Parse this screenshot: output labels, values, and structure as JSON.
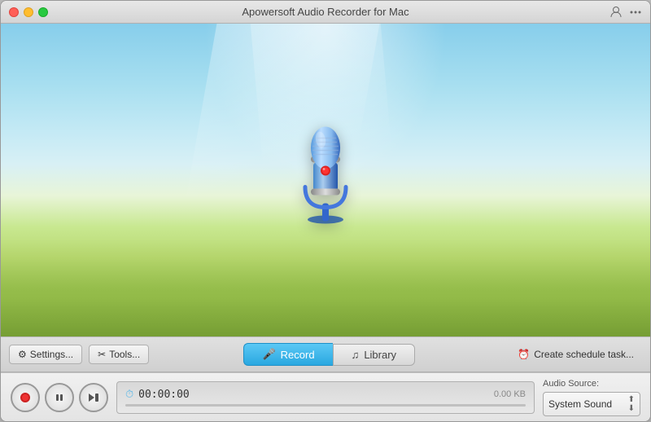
{
  "window": {
    "title": "Apowersoft Audio Recorder for Mac"
  },
  "toolbar": {
    "settings_label": "Settings...",
    "tools_label": "Tools...",
    "record_tab": "Record",
    "library_tab": "Library",
    "schedule_label": "Create schedule task..."
  },
  "controls": {
    "timer": "00:00:00",
    "file_size": "0.00 KB"
  },
  "audio_source": {
    "label": "Audio Source:",
    "value": "System Sound"
  }
}
